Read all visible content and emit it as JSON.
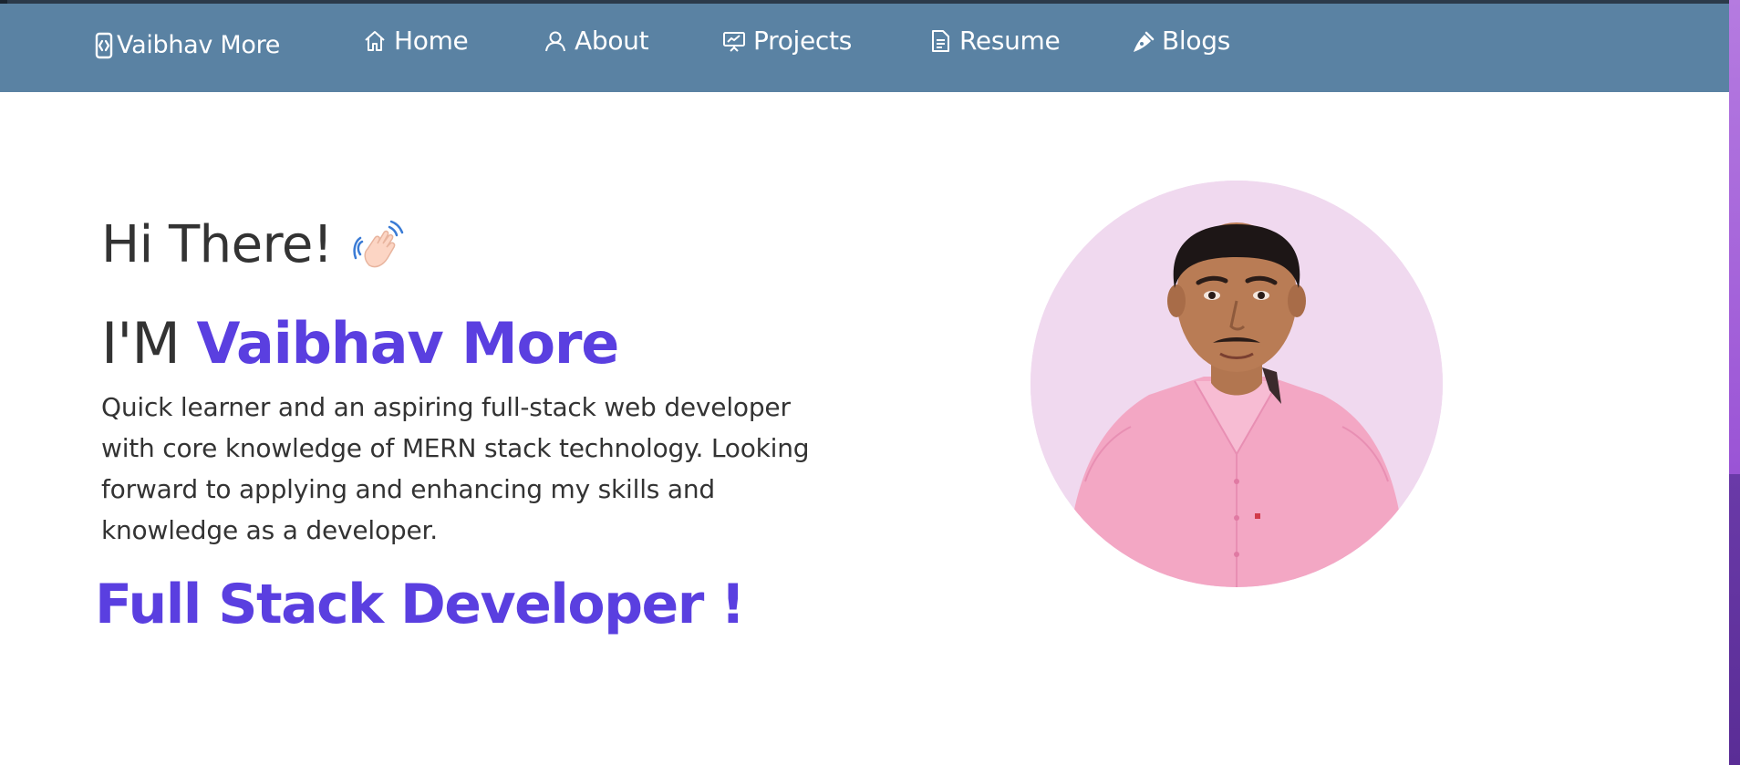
{
  "colors": {
    "navbar_bg": "#5a82a3",
    "accent": "#5a3fe0",
    "text": "#333333",
    "avatar_bg": "#f0d9ef",
    "scrollbar": "#9b55d6"
  },
  "navbar": {
    "brand": {
      "label": "Vaibhav More",
      "icon": "code-phone-icon"
    },
    "items": [
      {
        "label": "Home",
        "icon": "home-icon"
      },
      {
        "label": "About",
        "icon": "user-icon"
      },
      {
        "label": "Projects",
        "icon": "presentation-chart-icon"
      },
      {
        "label": "Resume",
        "icon": "document-icon"
      },
      {
        "label": "Blogs",
        "icon": "pen-nib-icon"
      }
    ]
  },
  "hero": {
    "greeting": "Hi There!",
    "greeting_icon": "waving-hand-icon",
    "intro_prefix": "I'M",
    "name": "Vaibhav More",
    "description": "Quick learner and an aspiring full-stack web developer with core knowledge of MERN stack technology. Looking forward to applying and enhancing my skills and knowledge as a developer.",
    "role": "Full Stack Developer !"
  },
  "avatar": {
    "alt": "profile photo"
  }
}
